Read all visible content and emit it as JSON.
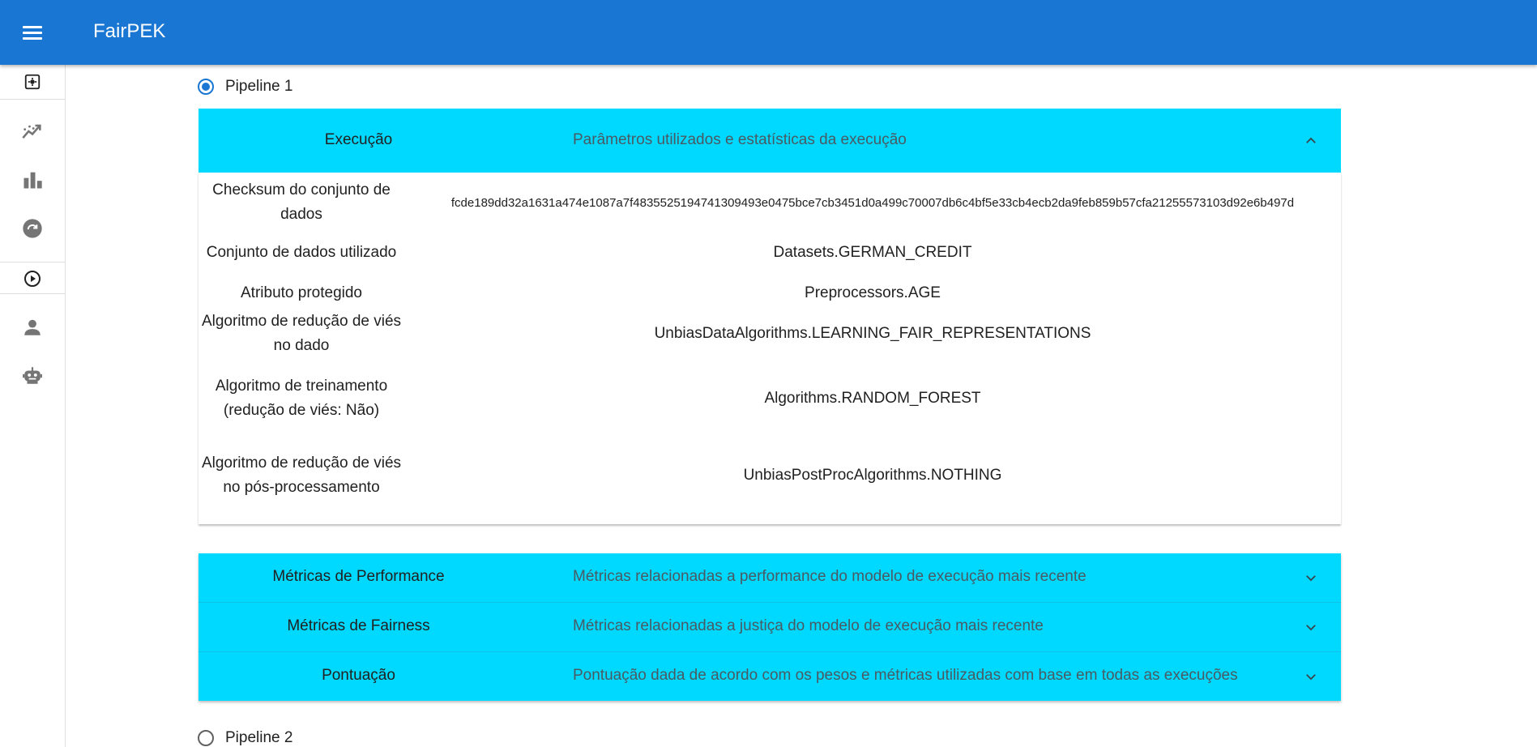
{
  "app": {
    "title": "FairPEK"
  },
  "icons": {
    "menu": "menu-icon",
    "nav": [
      "settings-box-icon",
      "trending-up-icon",
      "bar-chart-icon",
      "refresh-circle-icon",
      "play-circle-icon",
      "person-icon",
      "robot-icon"
    ]
  },
  "pipelines": [
    {
      "label": "Pipeline 1",
      "selected": true
    },
    {
      "label": "Pipeline 2",
      "selected": false
    }
  ],
  "execucao": {
    "title": "Execução",
    "description": "Parâmetros utilizados e estatísticas da execução",
    "rows": [
      {
        "key": "Checksum do conjunto de dados",
        "value": "fcde189dd32a1631a474e1087a7f483552519474130949\u00033e0475bce7cb3451d0a499c70007db6c4bf5e33cb4ecb2da9feb859b57cfa21255573103d92e6b497d"
      },
      {
        "key": "Conjunto de dados utilizado",
        "value": "Datasets.GERMAN_CREDIT"
      },
      {
        "key": "Atributo protegido",
        "value": "Preprocessors.AGE"
      },
      {
        "key": "Algoritmo de redução de viés no dado",
        "value": "UnbiasDataAlgorithms.LEARNING_FAIR_REPRESENTATIONS"
      },
      {
        "key": "Algoritmo de treinamento (redução de viés: Não)",
        "value": "Algorithms.RANDOM_FOREST"
      },
      {
        "key": "Algoritmo de redução de viés no pós-processamento",
        "value": "UnbiasPostProcAlgorithms.NOTHING"
      }
    ]
  },
  "collapsed_panels": [
    {
      "title": "Métricas de Performance",
      "description": "Métricas relacionadas a performance do modelo de execução mais recente"
    },
    {
      "title": "Métricas de Fairness",
      "description": "Métricas relacionadas a justiça do modelo de execução mais recente"
    },
    {
      "title": "Pontuação",
      "description": "Pontuação dada de acordo com os pesos e métricas utilizadas com base em todas as execuções"
    }
  ],
  "colors": {
    "appbar": "#1976d2",
    "panel": "#00d9ff",
    "accent": "#1976d2"
  }
}
